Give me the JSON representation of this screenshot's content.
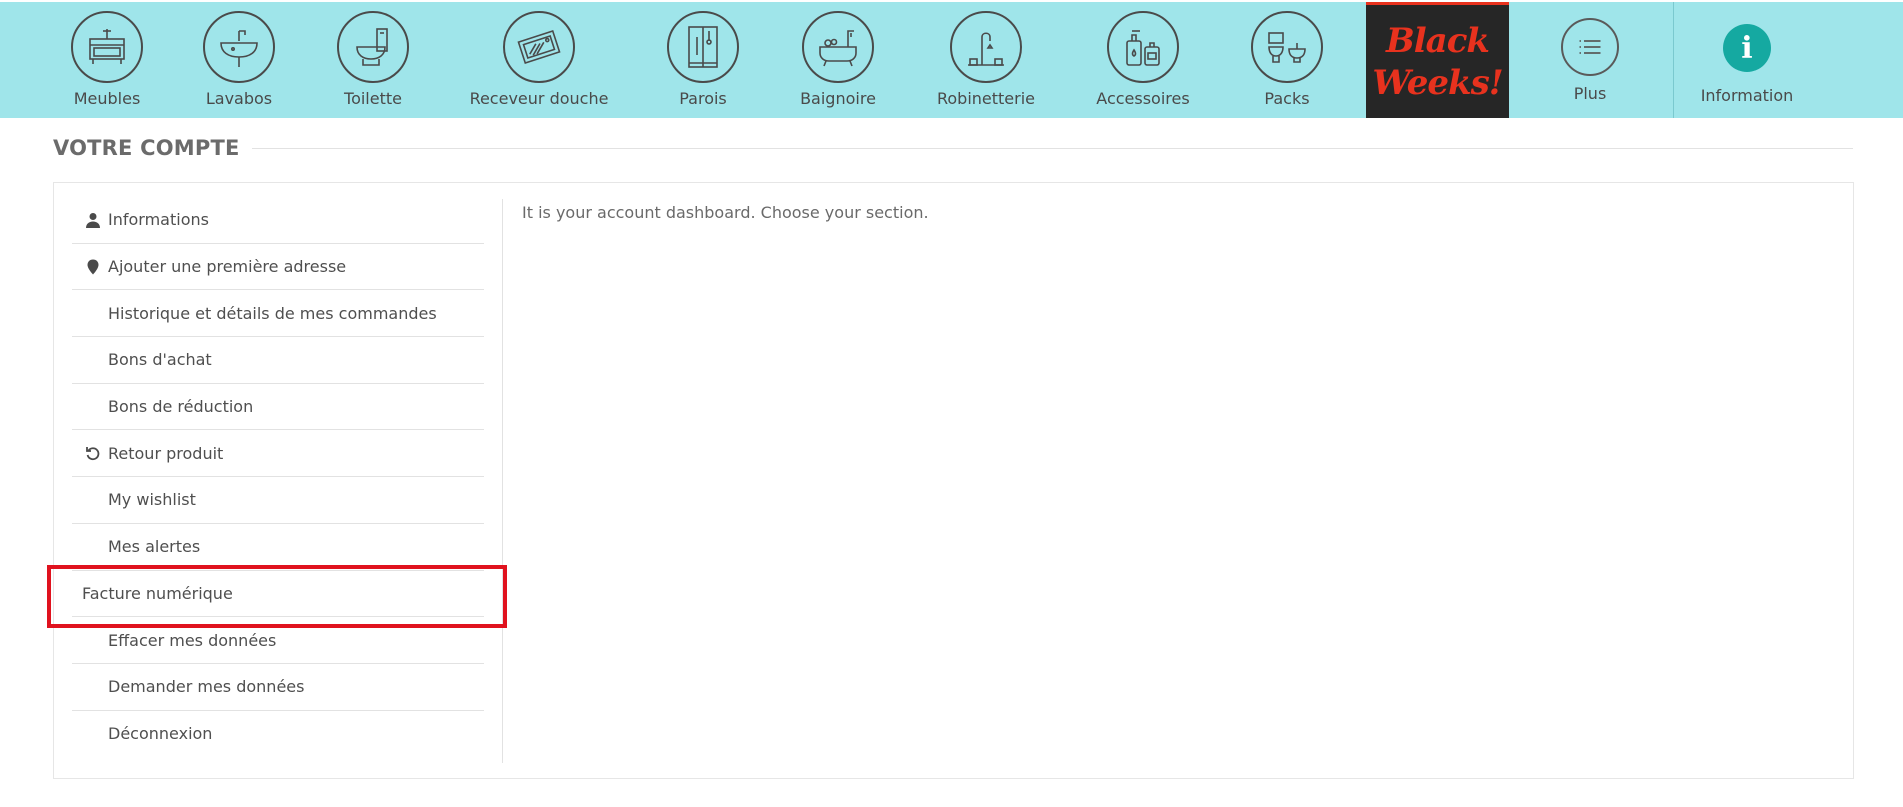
{
  "nav": {
    "items": [
      {
        "label": "Meubles",
        "icon": "vanity-cabinet-icon"
      },
      {
        "label": "Lavabos",
        "icon": "washbasin-icon"
      },
      {
        "label": "Toilette",
        "icon": "toilet-icon"
      },
      {
        "label": "Receveur douche",
        "icon": "shower-tray-icon"
      },
      {
        "label": "Parois",
        "icon": "shower-enclosure-icon"
      },
      {
        "label": "Baignoire",
        "icon": "bathtub-icon"
      },
      {
        "label": "Robinetterie",
        "icon": "faucet-icon"
      },
      {
        "label": "Accessoires",
        "icon": "soap-dispenser-icon"
      },
      {
        "label": "Packs",
        "icon": "toilet-bidet-pack-icon"
      }
    ],
    "promo": {
      "line1": "Black",
      "line2": "Weeks!"
    },
    "more": {
      "label": "Plus",
      "icon": "list-icon"
    },
    "info": {
      "label": "Information",
      "icon": "info-icon",
      "glyph": "i"
    },
    "colors": {
      "bar": "#9fe5ea",
      "promo_bg": "#262626",
      "promo_text": "#e8321e",
      "info_badge": "#15a9a1"
    }
  },
  "page": {
    "title": "VOTRE COMPTE",
    "dashboard_message": "It is your account dashboard. Choose your section."
  },
  "sidebar": {
    "items": [
      {
        "label": "Informations",
        "icon": "user-icon"
      },
      {
        "label": "Ajouter une première adresse",
        "icon": "map-pin-icon"
      },
      {
        "label": "Historique et détails de mes commandes",
        "icon": ""
      },
      {
        "label": "Bons d'achat",
        "icon": ""
      },
      {
        "label": "Bons de réduction",
        "icon": ""
      },
      {
        "label": "Retour produit",
        "icon": "undo-icon"
      },
      {
        "label": "My wishlist",
        "icon": ""
      },
      {
        "label": "Mes alertes",
        "icon": ""
      },
      {
        "label": "Facture numérique",
        "icon": "",
        "highlighted": true
      },
      {
        "label": "Effacer mes données",
        "icon": ""
      },
      {
        "label": "Demander mes données",
        "icon": ""
      },
      {
        "label": "Déconnexion",
        "icon": ""
      }
    ],
    "highlight_color": "#e0121e"
  }
}
